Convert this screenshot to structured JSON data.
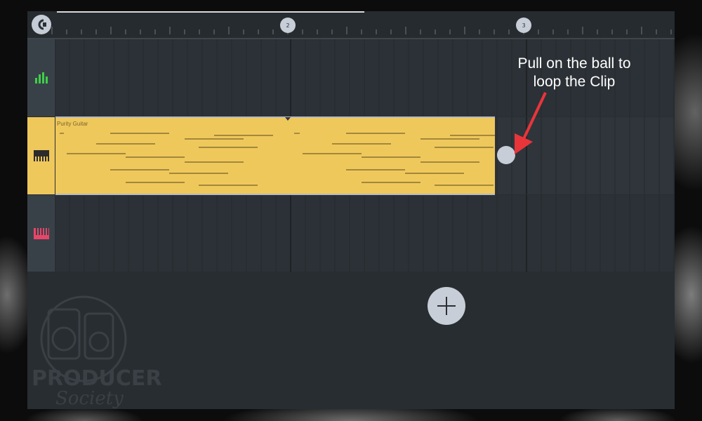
{
  "ruler": {
    "bar_markers": [
      "2",
      "3"
    ]
  },
  "tracks": [
    {
      "icon": "bars-icon",
      "color": "#3ecf4a"
    },
    {
      "icon": "piano-keys-icon",
      "color": "#2b2b2b",
      "selected": true
    },
    {
      "icon": "piano-keys-icon",
      "color": "#e8456a"
    }
  ],
  "clip": {
    "name": "Purity Guitar",
    "color": "#efc85c"
  },
  "annotation": {
    "line1": "Pull on the ball to",
    "line2": "loop the Clip",
    "arrow_color": "#e8353a"
  },
  "watermark": {
    "word1": "PRODUCER",
    "word2": "Society"
  }
}
